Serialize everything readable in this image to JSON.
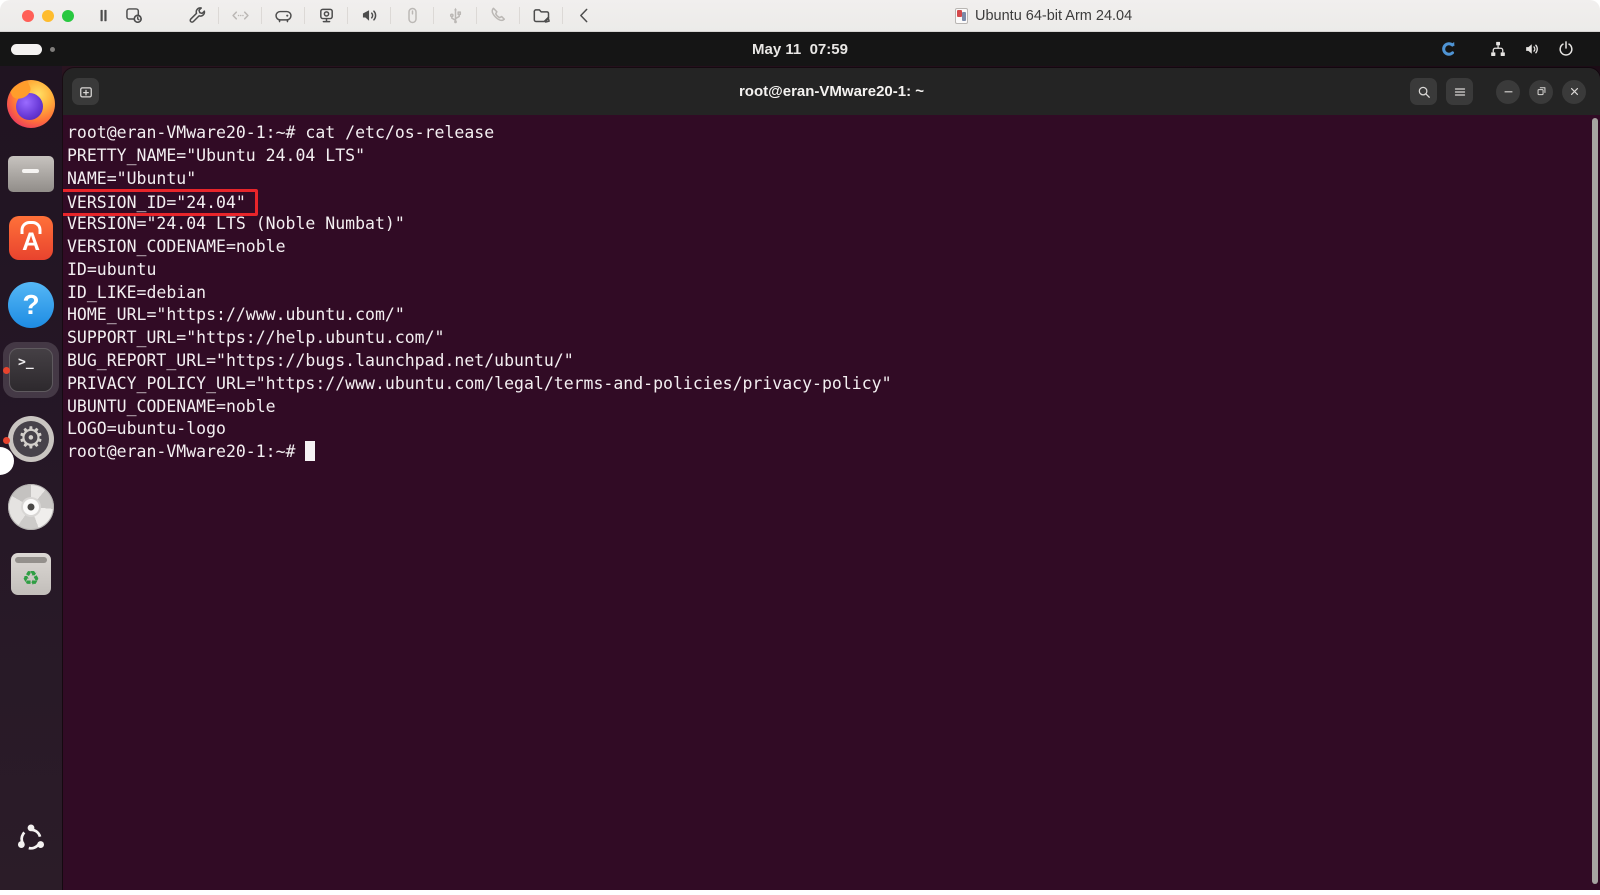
{
  "vmware_toolbar": {
    "vm_title": "Ubuntu 64-bit Arm 24.04",
    "traffic_lights": [
      {
        "name": "close-window-button",
        "color": "#ff5f57"
      },
      {
        "name": "minimize-window-button",
        "color": "#febc2e"
      },
      {
        "name": "zoom-window-button",
        "color": "#28c840"
      }
    ],
    "vm_control_buttons": [
      {
        "icon": "pause-icon",
        "enabled": true
      },
      {
        "icon": "snapshot-icon",
        "enabled": true
      }
    ],
    "device_buttons": [
      {
        "icon": "settings-wrench-icon",
        "enabled": true
      },
      {
        "icon": "send-keys-icon",
        "enabled": false
      },
      {
        "icon": "hard-disk-icon",
        "enabled": true
      },
      {
        "icon": "camera-icon",
        "enabled": true
      },
      {
        "icon": "sound-icon",
        "enabled": true
      },
      {
        "icon": "mouse-icon",
        "enabled": false
      },
      {
        "icon": "usb-icon",
        "enabled": false
      },
      {
        "icon": "phone-icon",
        "enabled": false
      },
      {
        "icon": "shared-folder-icon",
        "enabled": true
      },
      {
        "icon": "collapse-toolbar-icon",
        "enabled": true
      }
    ]
  },
  "top_bar": {
    "clock": "May 11  07:59",
    "status_icons": [
      "c-app-indicator-icon",
      "network-icon",
      "volume-icon",
      "power-icon"
    ],
    "accent_blue": "#4f94d4"
  },
  "terminal": {
    "title": "root@eran-VMware20-1: ~",
    "bg_color": "#310b25",
    "highlight_color": "#e8252a",
    "lines": [
      {
        "text": "root@eran-VMware20-1:~# cat /etc/os-release"
      },
      {
        "text": "PRETTY_NAME=\"Ubuntu 24.04 LTS\""
      },
      {
        "text": "NAME=\"Ubuntu\""
      },
      {
        "text": "VERSION_ID=\"24.04\"",
        "highlight": true
      },
      {
        "text": "VERSION=\"24.04 LTS (Noble Numbat)\""
      },
      {
        "text": "VERSION_CODENAME=noble"
      },
      {
        "text": "ID=ubuntu"
      },
      {
        "text": "ID_LIKE=debian"
      },
      {
        "text": "HOME_URL=\"https://www.ubuntu.com/\""
      },
      {
        "text": "SUPPORT_URL=\"https://help.ubuntu.com/\""
      },
      {
        "text": "BUG_REPORT_URL=\"https://bugs.launchpad.net/ubuntu/\""
      },
      {
        "text": "PRIVACY_POLICY_URL=\"https://www.ubuntu.com/legal/terms-and-policies/privacy-policy\""
      },
      {
        "text": "UBUNTU_CODENAME=noble"
      },
      {
        "text": "LOGO=ubuntu-logo"
      },
      {
        "text": "root@eran-VMware20-1:~# ",
        "cursor": true
      }
    ]
  },
  "dock": {
    "items": [
      {
        "id": "firefox"
      },
      {
        "id": "files"
      },
      {
        "id": "app-center"
      },
      {
        "id": "help"
      },
      {
        "id": "terminal",
        "active": true,
        "running": true
      },
      {
        "id": "settings",
        "running": true
      },
      {
        "id": "disc"
      },
      {
        "id": "trash"
      },
      {
        "id": "show-apps"
      }
    ]
  }
}
